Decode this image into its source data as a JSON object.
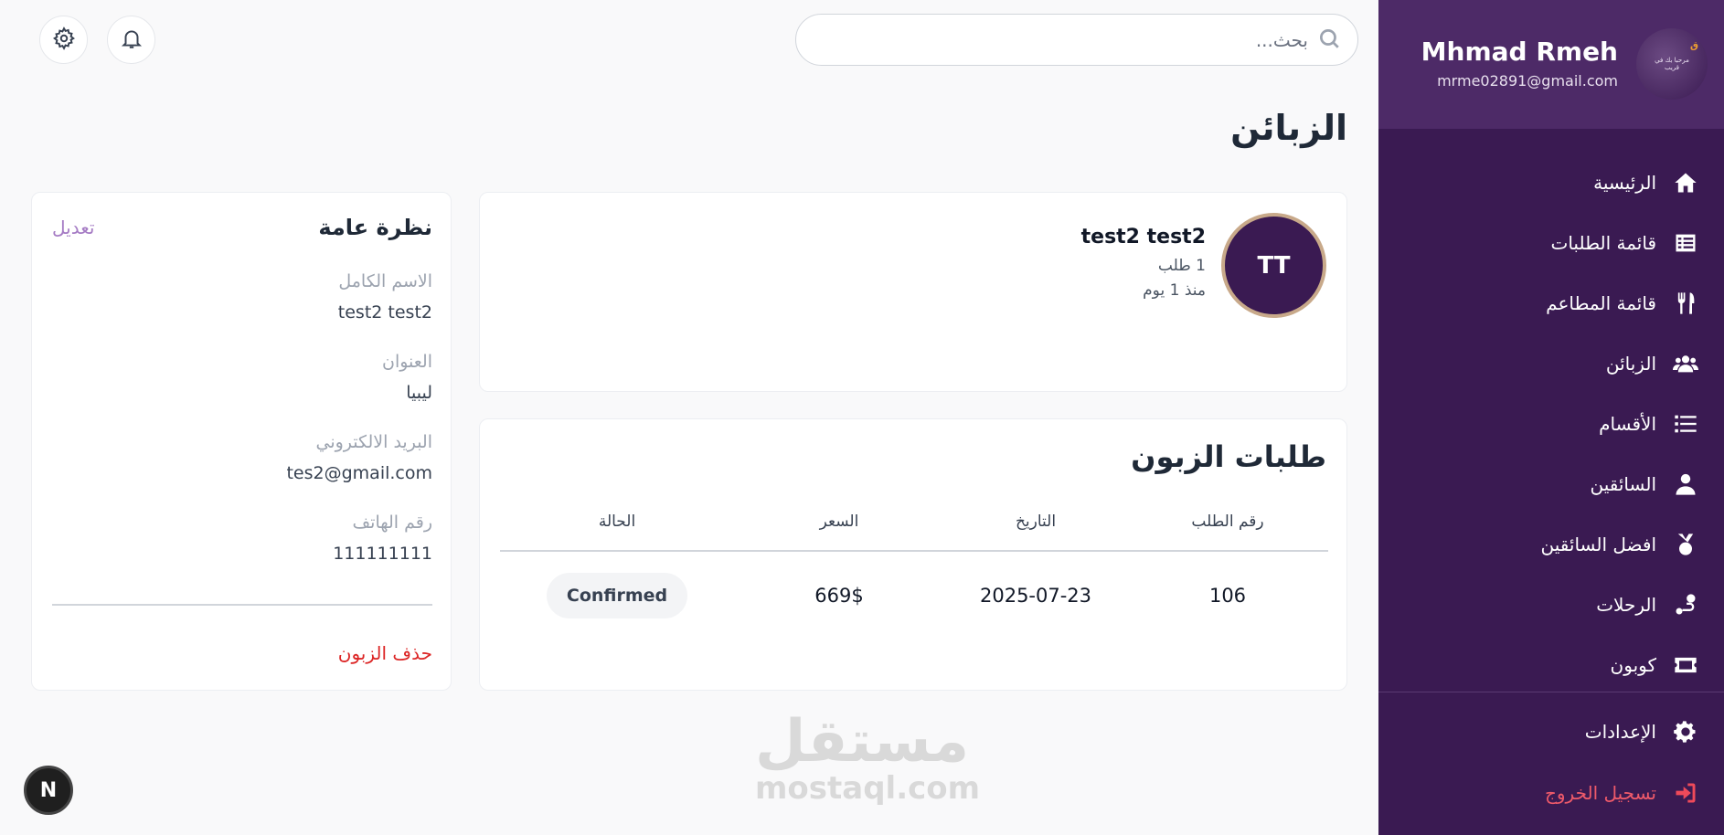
{
  "sidebar": {
    "profile": {
      "name": "Mhmad Rmeh",
      "email": "mrme02891@gmail.com",
      "avatar_text": "مرحبا بك في قريب"
    },
    "items": [
      {
        "label": "الرئيسية",
        "icon": "home-icon"
      },
      {
        "label": "قائمة الطلبات",
        "icon": "list-table-icon"
      },
      {
        "label": "قائمة المطاعم",
        "icon": "utensils-icon"
      },
      {
        "label": "الزبائن",
        "icon": "users-icon"
      },
      {
        "label": "الأقسام",
        "icon": "list-icon"
      },
      {
        "label": "السائقين",
        "icon": "driver-icon"
      },
      {
        "label": "افضل السائقين",
        "icon": "medal-icon"
      },
      {
        "label": "الرحلات",
        "icon": "route-icon"
      },
      {
        "label": "كوبون",
        "icon": "ticket-icon"
      }
    ],
    "settings_label": "الإعدادات",
    "logout_label": "تسجيل الخروج",
    "colors": {
      "bg": "#3a1a52",
      "profile_bg": "#4d2a67",
      "logout": "#ef4a5a"
    }
  },
  "header": {
    "search_placeholder": "بحث..."
  },
  "page_title": "الزبائن",
  "customer": {
    "initials": "TT",
    "name": "test2 test2",
    "orders_count": "1 طلب",
    "since": "منذ 1 يوم"
  },
  "orders": {
    "title": "طلبات الزبون",
    "columns": [
      "رقم الطلب",
      "التاريخ",
      "السعر",
      "الحالة"
    ],
    "rows": [
      {
        "id": "106",
        "date": "2025-07-23",
        "price": "669$",
        "status": "Confirmed"
      }
    ]
  },
  "overview": {
    "title": "نظرة عامة",
    "edit_label": "تعديل",
    "fields": [
      {
        "label": "الاسم الكامل",
        "value": "test2 test2"
      },
      {
        "label": "العنوان",
        "value": "ليبيا"
      },
      {
        "label": "البريد الالكتروني",
        "value": "tes2@gmail.com"
      },
      {
        "label": "رقم الهاتف",
        "value": "111111111"
      }
    ],
    "delete_label": "حذف الزبون"
  },
  "watermark": {
    "line1": "مستقل",
    "line2": "mostaql.com"
  },
  "next_badge": "N"
}
